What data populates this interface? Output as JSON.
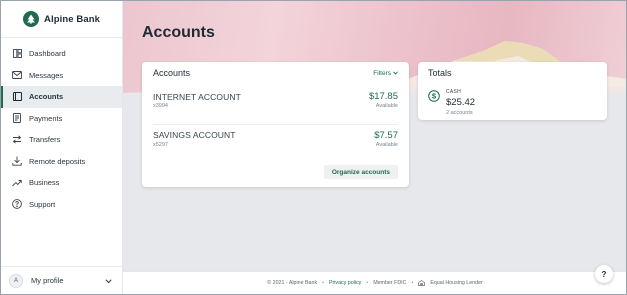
{
  "brand": {
    "name": "Alpine Bank",
    "icon": "pine-tree-logo",
    "color": "#1e6b4e"
  },
  "sidebar": {
    "items": [
      {
        "label": "Dashboard",
        "icon": "dashboard-icon",
        "active": false
      },
      {
        "label": "Messages",
        "icon": "mail-icon",
        "active": false
      },
      {
        "label": "Accounts",
        "icon": "wallet-icon",
        "active": true
      },
      {
        "label": "Payments",
        "icon": "receipt-icon",
        "active": false
      },
      {
        "label": "Transfers",
        "icon": "swap-icon",
        "active": false
      },
      {
        "label": "Remote deposits",
        "icon": "download-icon",
        "active": false
      },
      {
        "label": "Business",
        "icon": "trending-up-icon",
        "active": false
      },
      {
        "label": "Support",
        "icon": "help-circle-icon",
        "active": false
      }
    ],
    "profile": {
      "initial": "A",
      "label": "My profile"
    }
  },
  "main": {
    "title": "Accounts",
    "accounts_card": {
      "title": "Accounts",
      "filters_label": "Filters",
      "accounts": [
        {
          "name": "INTERNET ACCOUNT",
          "number": "x3994",
          "balance": "$17.85",
          "balance_label": "Available"
        },
        {
          "name": "SAVINGS ACCOUNT",
          "number": "x5297",
          "balance": "$7.57",
          "balance_label": "Available"
        }
      ],
      "organize_label": "Organize accounts"
    },
    "totals_card": {
      "title": "Totals",
      "category": "CASH",
      "amount": "$25.42",
      "count": "2 accounts"
    }
  },
  "footer": {
    "copyright": "© 2021 - Alpine Bank",
    "privacy": "Privacy policy",
    "fdic": "Member FDIC",
    "housing": "Equal Housing Lender"
  },
  "help_label": "?"
}
